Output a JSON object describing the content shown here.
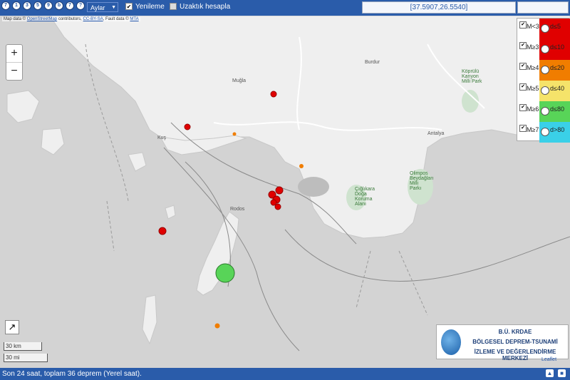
{
  "toolbar": {
    "icons": [
      "7",
      "1",
      "3",
      "5",
      "9",
      "b",
      "7",
      "?"
    ],
    "period_select": "Aylar",
    "refresh_label": "Yenileme",
    "refresh_checked": "✔",
    "remote_label": "Uzaktık hesapla",
    "coords": "[37.5907,26.5540]"
  },
  "map": {
    "attribution_prefix": "Map data ©",
    "attribution_osm": "OpenStreetMap",
    "attribution_mid": "contributors,",
    "attribution_license": "CC-BY-SA",
    "attribution_fault": ", Fault data ©",
    "attribution_mta": "MTA",
    "zoom_in": "+",
    "zoom_out": "−",
    "labels": {
      "mugla": "Muğla",
      "burdur": "Burdur",
      "antalya": "Antalya",
      "kus": "Kuş",
      "rodos": "Rodos",
      "koprulu": "Köprülü Kanyon Milli Park",
      "olimpos": "Olimpos Beydağları Milli Parkı",
      "cigdem": "Çığlıkara Doğa Koruma Alanı"
    }
  },
  "legend": {
    "rows": [
      {
        "mag": "M<3",
        "depth": "d≤5",
        "band_color": "#e00000",
        "check": "✔"
      },
      {
        "mag": "M≥3",
        "depth": "d≤10",
        "band_color": "#e00000",
        "check": "✔"
      },
      {
        "mag": "M≥4",
        "depth": "d≤20",
        "band_color": "#f07d00",
        "check": "✔"
      },
      {
        "mag": "M≥5",
        "depth": "d≤40",
        "band_color": "#f5e36a",
        "check": "✔"
      },
      {
        "mag": "M≥6",
        "depth": "d≤80",
        "band_color": "#58d458",
        "check": "✔"
      },
      {
        "mag": "M≥7",
        "depth": "d>80",
        "band_color": "#3ad0e8",
        "check": "✔"
      }
    ]
  },
  "scale": {
    "km": "30 km",
    "mi": "30 mi"
  },
  "logo": {
    "line1": "B.Ü. KRDAE",
    "line2": "BÖLGESEL DEPREM-TSUNAMİ",
    "line3": "İZLEME VE DEĞERLENDİRME MERKEZİ",
    "leaflet": "Leaflet"
  },
  "status": {
    "text": "Son 24 saat, toplam 36 deprem (Yerel saat)."
  },
  "colors": {
    "toolbar": "#2a5caa",
    "sea": "#d3d3d3",
    "land": "#efefef",
    "quake_red": "#e00000",
    "quake_orange": "#f07d00",
    "quake_green": "#58d458"
  }
}
